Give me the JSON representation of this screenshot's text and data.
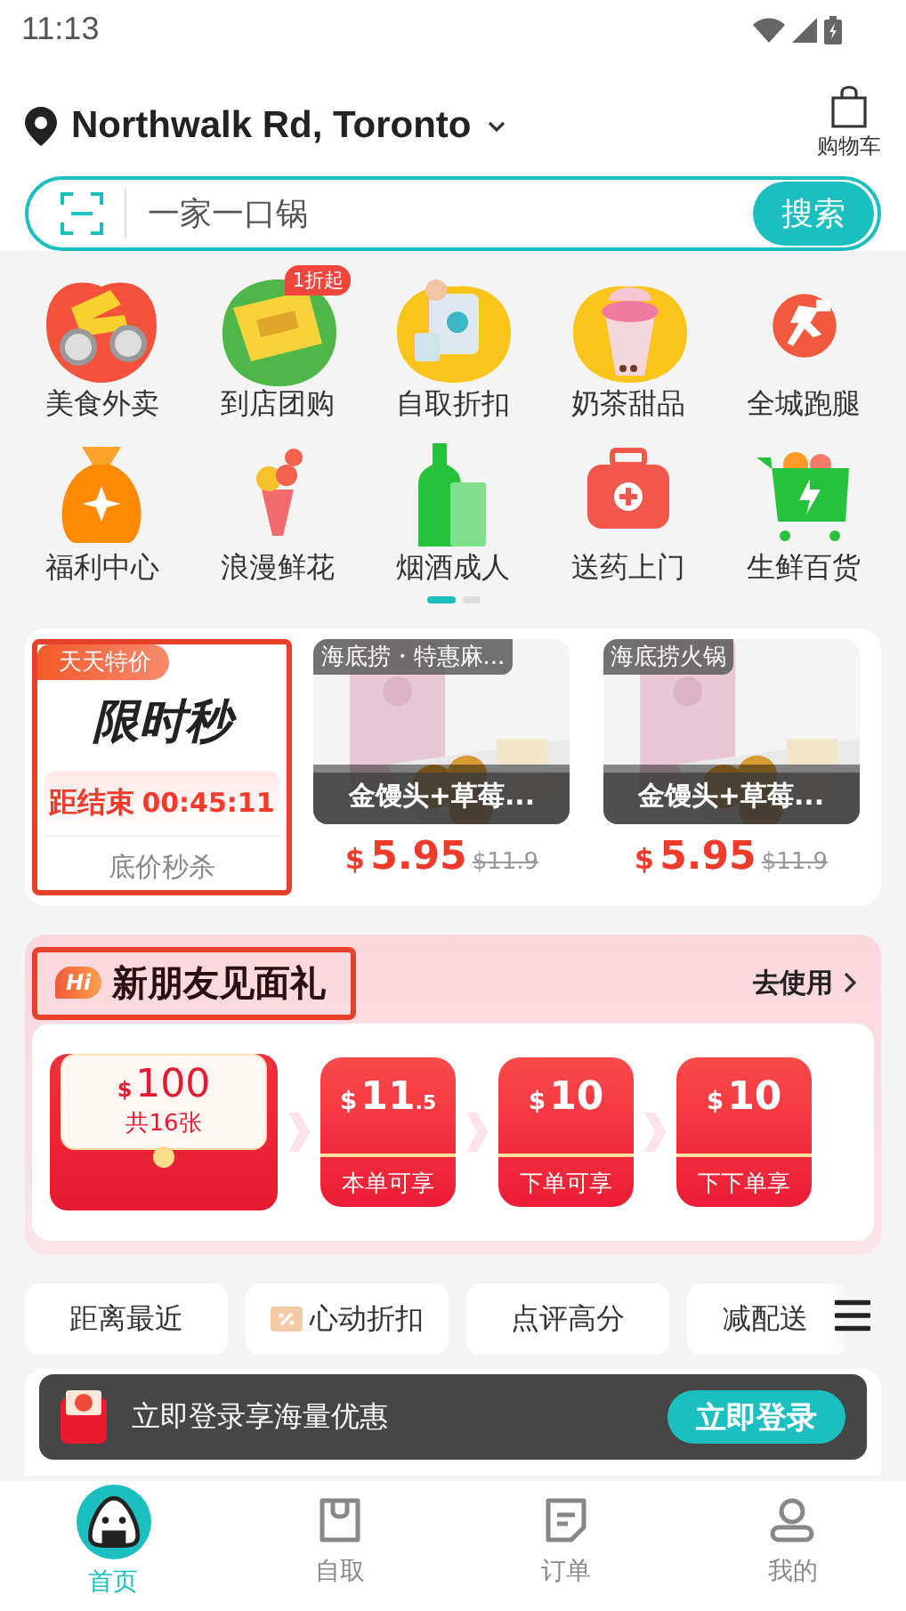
{
  "status_bar": {
    "time": "11:13"
  },
  "header": {
    "location": "Northwalk Rd, Toronto",
    "cart_label": "购物车"
  },
  "search": {
    "placeholder": "一家一口锅",
    "button": "搜索"
  },
  "categories": [
    {
      "label": "美食外卖",
      "kind": "scooter"
    },
    {
      "label": "到店团购",
      "kind": "ticket",
      "badge": "1折起"
    },
    {
      "label": "自取折扣",
      "kind": "bag"
    },
    {
      "label": "奶茶甜品",
      "kind": "cup"
    },
    {
      "label": "全城跑腿",
      "kind": "runner"
    },
    {
      "label": "福利中心",
      "kind": "moneybag"
    },
    {
      "label": "浪漫鲜花",
      "kind": "flower"
    },
    {
      "label": "烟酒成人",
      "kind": "bottle"
    },
    {
      "label": "送药上门",
      "kind": "medkit"
    },
    {
      "label": "生鲜百货",
      "kind": "cart"
    }
  ],
  "pager": [
    {
      "selected": true
    },
    {
      "selected": false
    }
  ],
  "flash_sale": {
    "highlighted": true,
    "tag": "天天特价",
    "title": "限时秒",
    "countdown_label": "距结束",
    "countdown": "00:45:11",
    "subtitle": "底价秒杀",
    "products": [
      {
        "store": "海底捞・特惠麻...",
        "name": "金馒头+草莓...",
        "currency": "$",
        "price": "5.95",
        "original_price": "$11.9"
      },
      {
        "store": "海底捞火锅",
        "name": "金馒头+草莓...",
        "currency": "$",
        "price": "5.95",
        "original_price": "$11.9"
      }
    ]
  },
  "new_user_gift": {
    "highlighted": true,
    "badge": "Hi",
    "title": "新朋友见面礼",
    "link": "去使用",
    "bundle": {
      "currency": "$",
      "amount": "100",
      "count": "共16张"
    },
    "coupons": [
      {
        "currency": "$",
        "amount": "11",
        "decimal": ".5",
        "condition": "本单可享"
      },
      {
        "currency": "$",
        "amount": "10",
        "condition": "下单可享"
      },
      {
        "currency": "$",
        "amount": "10",
        "condition": "下下单享"
      }
    ]
  },
  "filters": [
    {
      "label": "距离最近"
    },
    {
      "label": "心动折扣",
      "kind": "discount"
    },
    {
      "label": "点评高分"
    },
    {
      "label": "减配送"
    }
  ],
  "login_toast": {
    "message": "立即登录享海量优惠",
    "button": "立即登录"
  },
  "bottom_nav": [
    {
      "label": "首页",
      "kind": "home",
      "selected": true
    },
    {
      "label": "自取",
      "kind": "bag",
      "selected": false
    },
    {
      "label": "订单",
      "kind": "order",
      "selected": false
    },
    {
      "label": "我的",
      "kind": "user",
      "selected": false
    }
  ]
}
